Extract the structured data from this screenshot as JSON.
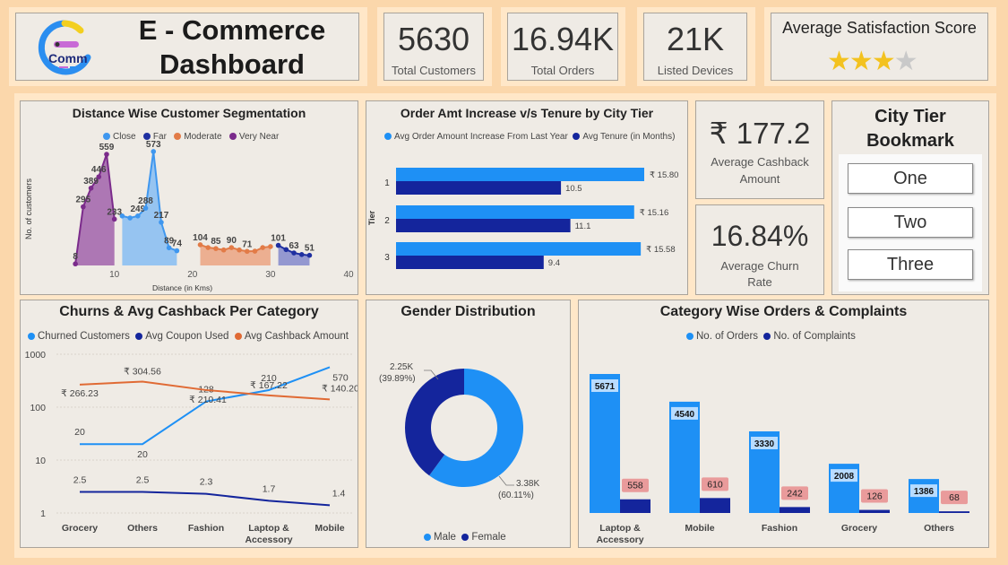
{
  "header": {
    "logo_text": "Comm",
    "title_line1": "E - Commerce",
    "title_line2": "Dashboard"
  },
  "kpis": [
    {
      "value": "5630",
      "label": "Total Customers"
    },
    {
      "value": "16.94K",
      "label": "Total Orders"
    },
    {
      "value": "21K",
      "label": "Listed Devices"
    }
  ],
  "satisfaction": {
    "title": "Average Satisfaction Score",
    "stars_filled": 3,
    "stars_total": 4
  },
  "cashback_card": {
    "value": "₹ 177.2",
    "label_line1": "Average Cashback",
    "label_line2": "Amount"
  },
  "churn_card": {
    "value": "16.84%",
    "label_line1": "Average Churn",
    "label_line2": "Rate"
  },
  "city_tier": {
    "title_line1": "City Tier",
    "title_line2": "Bookmark",
    "buttons": [
      "One",
      "Two",
      "Three"
    ]
  },
  "colors": {
    "close": "#3f97ef",
    "far": "#1f2fa0",
    "moderate": "#e27b47",
    "very_near": "#7b2b8b",
    "light_blue": "#1e90f5",
    "dark_blue": "#14259c",
    "orange": "#e06a34"
  },
  "chart_data": [
    {
      "id": "distance",
      "type": "area",
      "title": "Distance Wise Customer Segmentation",
      "xlabel": "Distance (in Kms)",
      "ylabel": "No. of customers",
      "xticks": [
        "10",
        "20",
        "30",
        "40"
      ],
      "legend": [
        "Close",
        "Far",
        "Moderate",
        "Very Near"
      ],
      "series": [
        {
          "name": "Very Near",
          "points": [
            [
              5,
              8
            ],
            [
              6,
              295
            ],
            [
              7,
              389
            ],
            [
              8,
              446
            ],
            [
              9,
              559
            ],
            [
              10,
              233
            ]
          ],
          "labels": [
            "8",
            "295",
            "389",
            "446",
            "559",
            "233"
          ]
        },
        {
          "name": "Close",
          "points": [
            [
              11,
              249
            ],
            [
              12,
              239
            ],
            [
              13,
              249
            ],
            [
              14,
              288
            ],
            [
              15,
              573
            ],
            [
              16,
              217
            ],
            [
              17,
              89
            ],
            [
              18,
              74
            ]
          ],
          "labels": [
            "",
            "",
            "249",
            "288",
            "573",
            "217",
            "89",
            "74"
          ]
        },
        {
          "name": "Moderate",
          "points": [
            [
              21,
              104
            ],
            [
              22,
              90
            ],
            [
              23,
              85
            ],
            [
              24,
              78
            ],
            [
              25,
              90
            ],
            [
              26,
              78
            ],
            [
              27,
              71
            ],
            [
              28,
              72
            ],
            [
              29,
              90
            ],
            [
              30,
              95
            ]
          ],
          "labels": [
            "104",
            "",
            "85",
            "",
            "90",
            "",
            "71",
            "",
            "",
            ""
          ]
        },
        {
          "name": "Far",
          "points": [
            [
              31,
              101
            ],
            [
              32,
              80
            ],
            [
              33,
              63
            ],
            [
              34,
              55
            ],
            [
              35,
              51
            ]
          ],
          "labels": [
            "101",
            "",
            "63",
            "",
            "51"
          ]
        }
      ]
    },
    {
      "id": "tenure",
      "type": "bar",
      "title": "Order Amt Increase v/s Tenure by City Tier",
      "ylabel": "Tier",
      "categories": [
        "1",
        "2",
        "3"
      ],
      "series": [
        {
          "name": "Avg Order Amount Increase From Last Year",
          "values": [
            15.8,
            15.16,
            15.58
          ],
          "labels": [
            "₹ 15.80",
            "₹ 15.16",
            "₹ 15.58"
          ]
        },
        {
          "name": "Avg Tenure (in Months)",
          "values": [
            10.5,
            11.1,
            9.4
          ],
          "labels": [
            "10.5",
            "11.1",
            "9.4"
          ]
        }
      ]
    },
    {
      "id": "churn",
      "type": "line",
      "title": "Churns & Avg Cashback Per Category",
      "log_scale": true,
      "yticks": [
        "1",
        "10",
        "100",
        "1000"
      ],
      "categories": [
        "Grocery",
        "Others",
        "Fashion",
        "Laptop &|Accessory",
        "Mobile"
      ],
      "series": [
        {
          "name": "Churned Customers",
          "values": [
            20,
            20,
            128,
            210,
            570
          ],
          "labels": [
            "20",
            "20",
            "128",
            "210",
            "570"
          ]
        },
        {
          "name": "Avg Coupon Used",
          "values": [
            2.5,
            2.5,
            2.3,
            1.7,
            1.4
          ],
          "labels": [
            "2.5",
            "2.5",
            "2.3",
            "1.7",
            "1.4"
          ]
        },
        {
          "name": "Avg Cashback Amount",
          "values": [
            266.23,
            304.56,
            210.41,
            167.22,
            140.2
          ],
          "labels": [
            "₹ 266.23",
            "₹ 304.56",
            "₹ 210.41",
            "₹ 167.22",
            "₹ 140.20"
          ]
        }
      ]
    },
    {
      "id": "gender",
      "type": "pie",
      "title": "Gender Distribution",
      "legend": [
        "Male",
        "Female"
      ],
      "slices": [
        {
          "name": "Male",
          "value": 3380,
          "label1": "3.38K",
          "label2": "(60.11%)"
        },
        {
          "name": "Female",
          "value": 2250,
          "label1": "2.25K",
          "label2": "(39.89%)"
        }
      ]
    },
    {
      "id": "orders",
      "type": "bar",
      "title": "Category Wise Orders & Complaints",
      "categories": [
        "Laptop &|Accessory",
        "Mobile",
        "Fashion",
        "Grocery",
        "Others"
      ],
      "series": [
        {
          "name": "No. of Orders",
          "values": [
            5671,
            4540,
            3330,
            2008,
            1386
          ]
        },
        {
          "name": "No. of Complaints",
          "values": [
            558,
            610,
            242,
            126,
            68
          ]
        }
      ]
    }
  ]
}
